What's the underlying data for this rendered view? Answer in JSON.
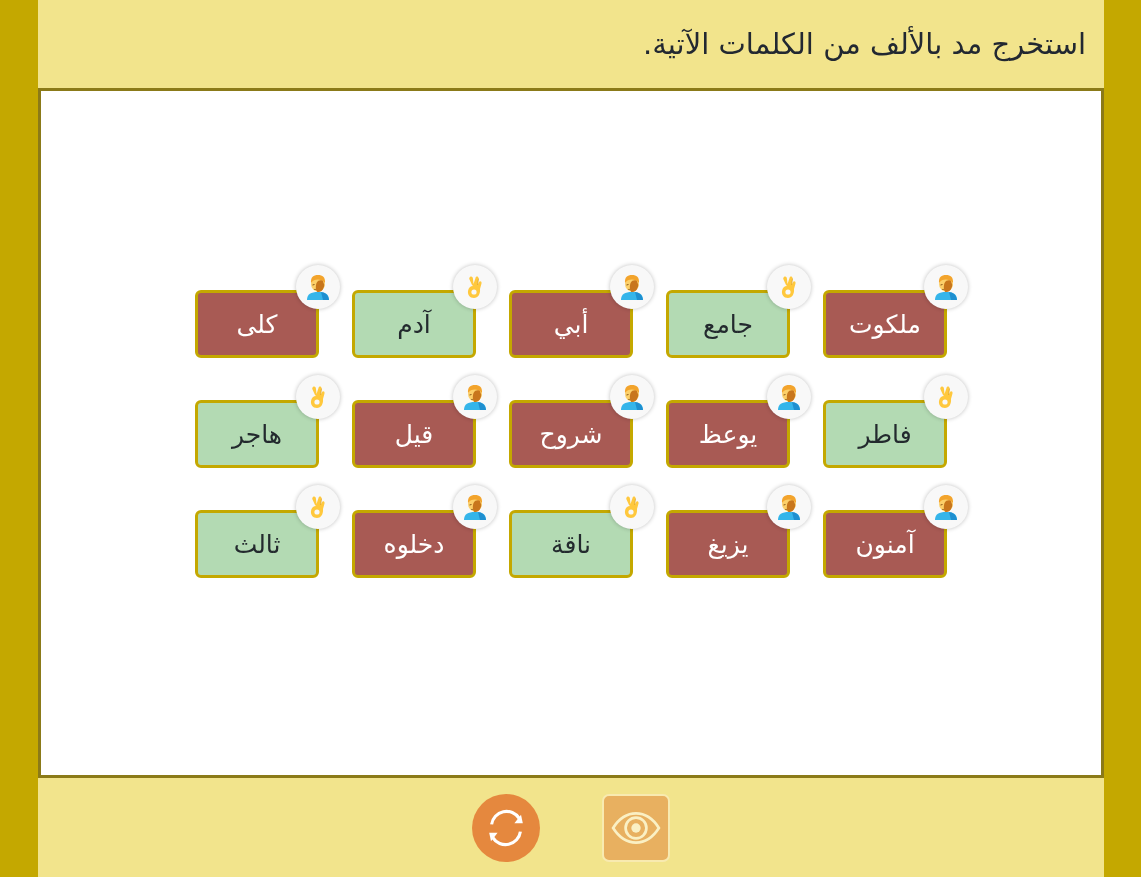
{
  "title": "استخرج مد بالألف من الكلمات الآتية.",
  "words": [
    {
      "text": "ملكوت",
      "correct": false
    },
    {
      "text": "جامع",
      "correct": true
    },
    {
      "text": "أبي",
      "correct": false
    },
    {
      "text": "آدم",
      "correct": true
    },
    {
      "text": "كلى",
      "correct": false
    },
    {
      "text": "فاطر",
      "correct": true
    },
    {
      "text": "يوعظ",
      "correct": false
    },
    {
      "text": "شروح",
      "correct": false
    },
    {
      "text": "قيل",
      "correct": false
    },
    {
      "text": "هاجر",
      "correct": true
    },
    {
      "text": "آمنون",
      "correct": false
    },
    {
      "text": "يزيغ",
      "correct": false
    },
    {
      "text": "ناقة",
      "correct": true
    },
    {
      "text": "دخلوه",
      "correct": false
    },
    {
      "text": "ثالث",
      "correct": true
    }
  ]
}
